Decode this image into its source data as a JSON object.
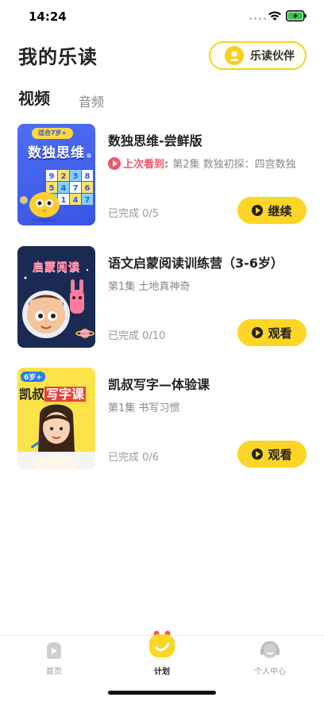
{
  "status_bar": {
    "time": "14:24"
  },
  "header": {
    "title": "我的乐读",
    "partner_button_label": "乐读伙伴"
  },
  "tabs": [
    {
      "label": "视频",
      "active": true
    },
    {
      "label": "音频",
      "active": false
    }
  ],
  "courses": [
    {
      "title": "数独思维-尝鲜版",
      "last_watched_label": "上次看到:",
      "last_watched_text": "第2集 数独初探：四宫数独",
      "progress": "已完成 0/5",
      "action_label": "继续",
      "cover": {
        "badge": "适合7岁+",
        "title": "数独思维",
        "grid": [
          "9",
          "2",
          "3",
          "8",
          "5",
          "4",
          "7",
          "6",
          "2",
          "1",
          "4",
          "7"
        ]
      }
    },
    {
      "title": "语文启蒙阅读训练营（3-6岁）",
      "subtitle": "第1集 土地真神奇",
      "progress": "已完成 0/10",
      "action_label": "观看",
      "cover": {
        "title": "启蒙阅读"
      }
    },
    {
      "title": "凯叔写字—体验课",
      "subtitle": "第1集 书写习惯",
      "progress": "已完成 0/6",
      "action_label": "观看",
      "cover": {
        "badge": "6岁+",
        "title_prefix": "凯叔",
        "title_highlight": "写字课"
      }
    }
  ],
  "bottom_nav": [
    {
      "label": "首页",
      "icon": "home-icon",
      "active": false
    },
    {
      "label": "计划",
      "icon": "plan-icon",
      "active": true
    },
    {
      "label": "个人中心",
      "icon": "profile-icon",
      "active": false
    }
  ],
  "colors": {
    "accent": "#fcd526",
    "highlight": "#f0566b",
    "muted": "#888888"
  }
}
